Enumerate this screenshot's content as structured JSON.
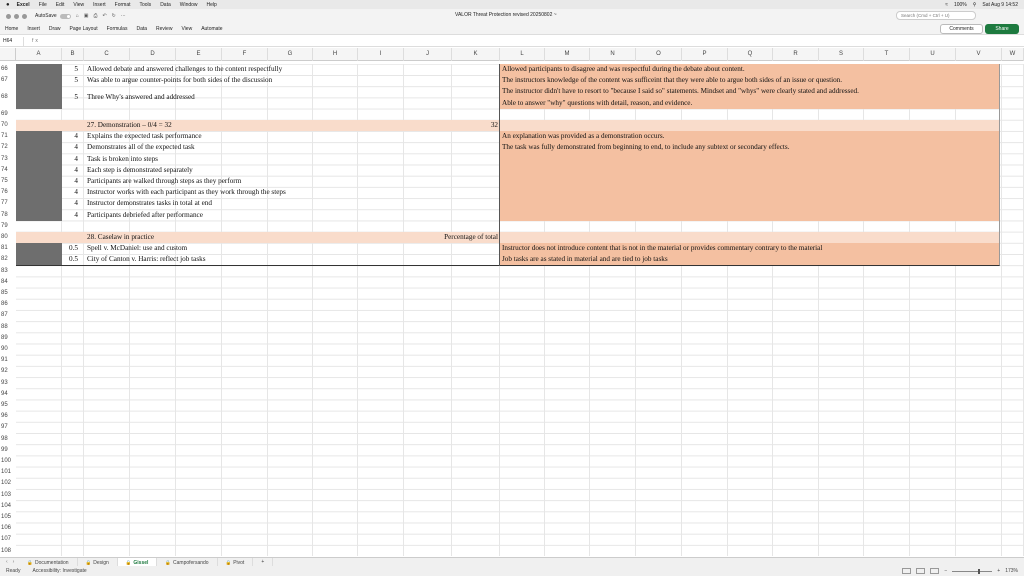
{
  "macbar": {
    "app": "Excel",
    "menus": [
      "File",
      "Edit",
      "View",
      "Insert",
      "Format",
      "Tools",
      "Data",
      "Window",
      "Help"
    ],
    "battery": "100%",
    "datetime": "Sat Aug 9 14:52"
  },
  "titlebar": {
    "autosave_label": "AutoSave",
    "doc_title": "VALOR Threat Protection revised 20250802 ~",
    "search_placeholder": "Search (Cmd + Ctrl + U)"
  },
  "ribbon": {
    "tabs": [
      "Home",
      "Insert",
      "Draw",
      "Page Layout",
      "Formulas",
      "Data",
      "Review",
      "View",
      "Automate"
    ],
    "comments_label": "Comments",
    "share_label": "Share"
  },
  "formula": {
    "namebox": "H64",
    "fx": "fx"
  },
  "columns": [
    "A",
    "B",
    "C",
    "D",
    "E",
    "F",
    "G",
    "H",
    "I",
    "J",
    "K",
    "L",
    "M",
    "N",
    "O",
    "P",
    "Q",
    "R",
    "S",
    "T",
    "U",
    "V",
    "W"
  ],
  "rows": [
    "66",
    "67",
    "",
    "68",
    "69",
    "70",
    "71",
    "72",
    "73",
    "74",
    "75",
    "76",
    "77",
    "78",
    "79",
    "80",
    "81",
    "82",
    "83",
    "84",
    "85",
    "86",
    "87",
    "88",
    "89",
    "90",
    "91",
    "92",
    "93",
    "94",
    "95",
    "96",
    "97",
    "98",
    "99",
    "100",
    "101",
    "102",
    "103",
    "104",
    "105",
    "106",
    "107",
    "108"
  ],
  "cells": {
    "r66b": "5",
    "r66c": "Allowed debate and answered challenges to the content respectfully",
    "r66l": "Allowed participants to disagree and was respectful during the debate about content.",
    "r67b": "5",
    "r67c": "Was able to argue counter-points for both sides of the discussion",
    "r67l": "The instructors knowledge of the content was sufficeint that they were able to argue both sides of an issue or question.",
    "r68b": "5",
    "r68c": "Three Why's answered and addressed",
    "r68l1": "The instructor didn't have to resort to \"because I said so\" statements. Mindset and \"whys\" were clearly stated and addressed.",
    "r68l2": "Able to answer \"why\" questions with detail, reason, and evidence.",
    "r70c": "27.  Demonstration – 0/4 = 32",
    "r70k": "32",
    "r71b": "4",
    "r71c": "Explains the expected task performance",
    "r71l": "An explanation was provided as a demonstration occurs.",
    "r72b": "4",
    "r72c": "Demonstrates all of the expected task",
    "r72l": "The task was fully demonstrated from beginning to end, to include any subtext or secondary effects.",
    "r73b": "4",
    "r73c": "Task is broken into steps",
    "r74b": "4",
    "r74c": "Each step is demonstrated separately",
    "r75b": "4",
    "r75c": "Participants are walked through steps as they perform",
    "r76b": "4",
    "r76c": "Instructor works with each participant as they work through the steps",
    "r77b": "4",
    "r77c": "Instructor demonstrates tasks in total at end",
    "r78b": "4",
    "r78c": "Participants debriefed after performance",
    "r80c": "28. Caselaw in practice",
    "r80j": "Percentage of total",
    "r81b": "0.5",
    "r81c": "Spell v. McDaniel: use and custom",
    "r81l": "Instructor does not introduce content that is not in the material or provides commentary contrary to the material",
    "r82b": "0.5",
    "r82c": "City of Canton v. Harris: reflect job tasks",
    "r82l": "Job tasks are as stated in material and are tied to job tasks"
  },
  "sheets": {
    "tabs": [
      "Documentation",
      "Design",
      "Gissel",
      "Campofersando",
      "Pivot"
    ],
    "active": "Gissel",
    "add": "+"
  },
  "status": {
    "ready": "Ready",
    "accessibility": "Accessibility: Investigate",
    "zoom": "173%"
  },
  "colors": {
    "peach": "#f4c0a1",
    "light_peach": "#f9dccb",
    "gray_fill": "#6e6e6e",
    "accent": "#1d7a3f"
  }
}
